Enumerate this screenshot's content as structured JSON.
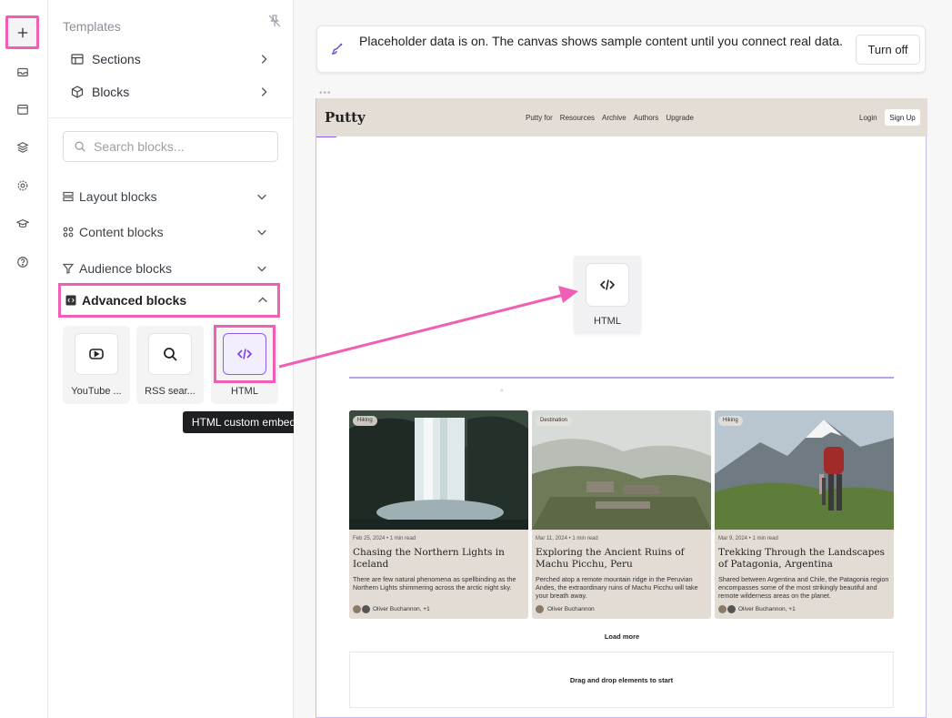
{
  "sidebar": {
    "templates_title": "Templates",
    "nav": [
      {
        "label": "Sections"
      },
      {
        "label": "Blocks"
      }
    ],
    "search_placeholder": "Search blocks...",
    "categories": [
      {
        "label": "Layout blocks"
      },
      {
        "label": "Content blocks"
      },
      {
        "label": "Audience blocks"
      },
      {
        "label": "Advanced blocks"
      }
    ],
    "tiles": [
      {
        "label": "YouTube ..."
      },
      {
        "label": "RSS sear..."
      },
      {
        "label": "HTML"
      }
    ],
    "tooltip": "HTML custom embed"
  },
  "notice": {
    "text": "Placeholder data is on. The canvas shows sample content until you connect real data.",
    "button": "Turn off"
  },
  "site": {
    "brand": "Putty",
    "nav": [
      "Putty for",
      "Resources",
      "Archive",
      "Authors",
      "Upgrade"
    ],
    "login": "Login",
    "signup": "Sign Up"
  },
  "drag_item": {
    "label": "HTML"
  },
  "cards": [
    {
      "tag": "Hiking",
      "meta": "Feb 25, 2024 • 1 min read",
      "title": "Chasing the Northern Lights in Iceland",
      "desc": "There are few natural phenomena as spellbinding as the Northern Lights shimmering across the arctic night sky.",
      "author": "Oliver Buchannon, +1"
    },
    {
      "tag": "Destination",
      "meta": "Mar 11, 2024 • 1 min read",
      "title": "Exploring the Ancient Ruins of Machu Picchu, Peru",
      "desc": "Perched atop a remote mountain ridge in the Peruvian Andes, the extraordinary ruins of Machu Picchu will take your breath away.",
      "author": "Oliver Buchannon"
    },
    {
      "tag": "Hiking",
      "meta": "Mar 9, 2024 • 1 min read",
      "title": "Trekking Through the Landscapes of Patagonia, Argentina",
      "desc": "Shared between Argentina and Chile, the Patagonia region encompasses some of the most strikingly beautiful and remote wilderness areas on the planet.",
      "author": "Oliver Buchannon, +1"
    }
  ],
  "load_more": "Load more",
  "dropzone": "Drag and drop elements to start",
  "colors": {
    "highlight": "#f05fb5",
    "accent": "#7c3aed",
    "site_bg": "#e4ddd6"
  }
}
